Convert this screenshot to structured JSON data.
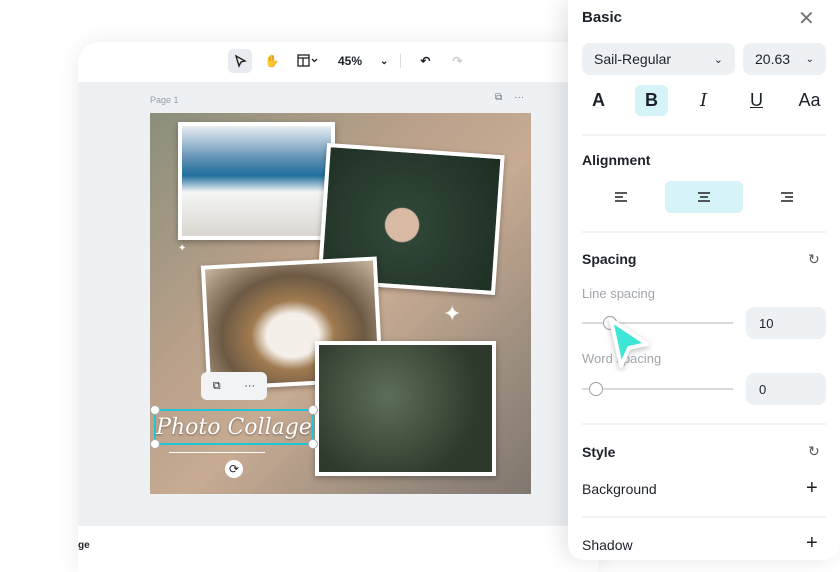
{
  "toolbar": {
    "zoom": "45%",
    "icons": [
      "select-pointer-icon",
      "hand-icon",
      "layout-icon",
      "undo-icon",
      "redo-icon"
    ]
  },
  "canvas": {
    "page_label": "Page 1",
    "text_element": "Photo Collage",
    "bottom_text": "ge"
  },
  "panel": {
    "title": "Basic",
    "font": "Sail-Regular",
    "font_size": "20.63",
    "format": {
      "color": "A",
      "bold": "B",
      "italic": "I",
      "underline": "U",
      "case": "Aa"
    },
    "alignment_label": "Alignment",
    "alignment_selected": "center",
    "spacing_label": "Spacing",
    "line_spacing_label": "Line spacing",
    "line_spacing": "10",
    "word_spacing_label": "Word spacing",
    "word_spacing": "0",
    "style_label": "Style",
    "background_label": "Background",
    "shadow_label": "Shadow"
  },
  "colors": {
    "accent": "#d6f3f8",
    "selection": "#1fc7d4",
    "cursor": "#3ee6d6"
  }
}
